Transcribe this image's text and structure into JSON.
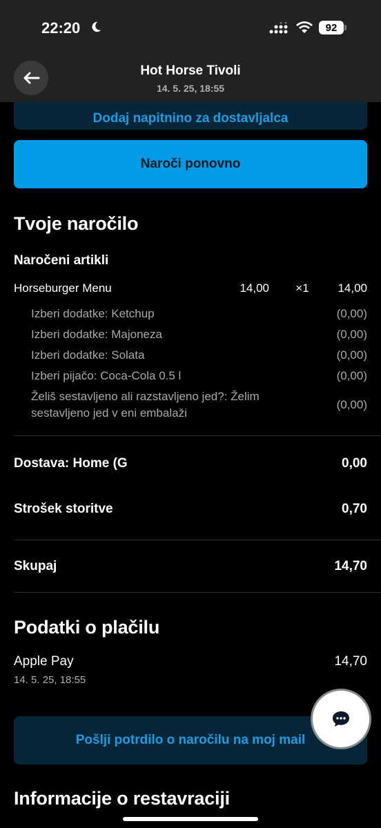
{
  "status_bar": {
    "time": "22:20",
    "battery": "92"
  },
  "nav": {
    "title": "Hot Horse Tivoli",
    "subtitle": "14. 5. 25, 18:55"
  },
  "tip_button": "Dodaj napitnino za dostavljalca",
  "reorder_button": "Naroči ponovno",
  "order_section": {
    "title": "Tvoje naročilo",
    "items_heading": "Naročeni artikli",
    "item": {
      "name": "Horseburger Menu",
      "price": "14,00",
      "qty": "×1",
      "total": "14,00"
    },
    "options": [
      {
        "label": "Izberi dodatke: Ketchup",
        "value": "(0,00)"
      },
      {
        "label": "Izberi dodatke: Majoneza",
        "value": "(0,00)"
      },
      {
        "label": "Izberi dodatke: Solata",
        "value": "(0,00)"
      },
      {
        "label": "Izberi pijačo: Coca-Cola 0.5 l",
        "value": "(0,00)"
      },
      {
        "label": "Želiš sestavljeno ali razstavljeno jed?: Želim sestavljeno jed v eni embalaži",
        "value": "(0,00)"
      }
    ]
  },
  "summary": {
    "delivery_label": "Dostava: Home (G",
    "delivery_value": "0,00",
    "service_label": "Strošek storitve",
    "service_value": "0,70",
    "total_label": "Skupaj",
    "total_value": "14,70"
  },
  "payment": {
    "title": "Podatki o plačilu",
    "method": "Apple Pay",
    "date": "14. 5. 25, 18:55",
    "amount": "14,70"
  },
  "email_button": "Pošlji potrdilo o naročilu na moj mail",
  "restaurant_title": "Informacije o restavraciji"
}
